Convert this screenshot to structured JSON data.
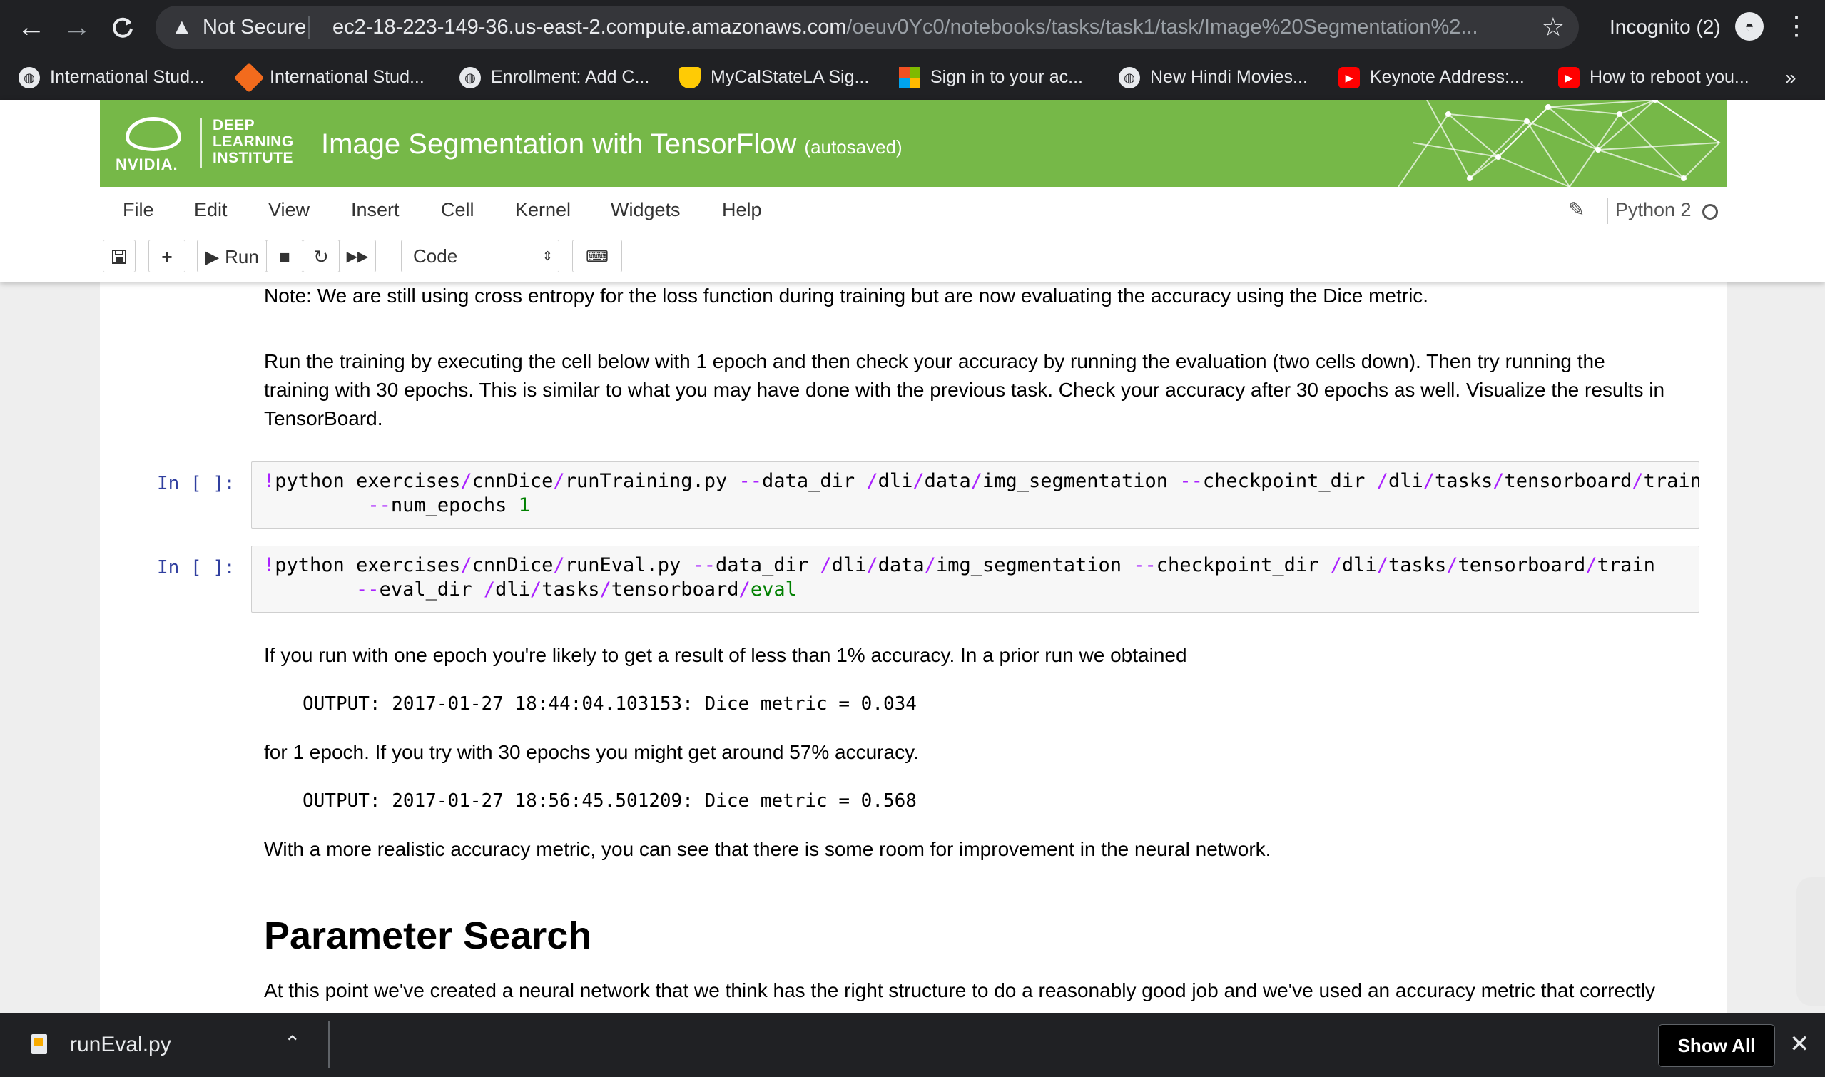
{
  "browser": {
    "nav": {
      "back": "←",
      "forward": "→",
      "reload": "C"
    },
    "security_text": "Not Secure",
    "url_host": "ec2-18-223-149-36.us-east-2.compute.amazonaws.com",
    "url_path": "/oeuv0Yc0/notebooks/tasks/task1/task/Image%20Segmentation%2...",
    "incognito_label": "Incognito (2)",
    "bookmarks": [
      {
        "label": "International Stud...",
        "icon": "globe-icon"
      },
      {
        "label": "International Stud...",
        "icon": "orange-diamond-icon"
      },
      {
        "label": "Enrollment: Add C...",
        "icon": "globe-icon"
      },
      {
        "label": "MyCalStateLA Sig...",
        "icon": "shield-icon"
      },
      {
        "label": "Sign in to your ac...",
        "icon": "microsoft-icon"
      },
      {
        "label": "New Hindi Movies...",
        "icon": "globe-icon"
      },
      {
        "label": "Keynote Address:...",
        "icon": "youtube-icon"
      },
      {
        "label": "How to reboot you...",
        "icon": "youtube-icon"
      }
    ],
    "bookmarks_more": "»"
  },
  "jupyter": {
    "logo_word": "NVIDIA.",
    "dli_lines": [
      "DEEP",
      "LEARNING",
      "INSTITUTE"
    ],
    "notebook_title": "Image Segmentation with TensorFlow",
    "autosave": "(autosaved)",
    "menu": [
      "File",
      "Edit",
      "View",
      "Insert",
      "Cell",
      "Kernel",
      "Widgets",
      "Help"
    ],
    "kernel_name": "Python 2",
    "toolbar": {
      "run_label": "Run",
      "cell_type": "Code"
    },
    "brand_color": "#76b848"
  },
  "notebook": {
    "note": "Note: We are still using cross entropy for the loss function during training but are now evaluating the accuracy using the Dice metric.",
    "run_para": [
      "Run the training by executing the cell below with 1 epoch and then check your accuracy by running the evaluation (two cells down). Then try running the",
      "training with 30 epochs. This is similar to what you may have done with the previous task. Check your accuracy after 30 epochs as well. Visualize the results in",
      "TensorBoard."
    ],
    "cell1_prompt": "In [ ]:",
    "cell2_prompt": "In [ ]:",
    "if_para": "If you run with one epoch you're likely to get a result of less than 1% accuracy. In a prior run we obtained",
    "output1": "OUTPUT: 2017-01-27 18:44:04.103153: Dice metric = 0.034",
    "for_para": "for 1 epoch. If you try with 30 epochs you might get around 57% accuracy.",
    "output2": "OUTPUT: 2017-01-27 18:56:45.501209: Dice metric = 0.568",
    "with_para": "With a more realistic accuracy metric, you can see that there is some room for improvement in the neural network.",
    "heading": "Parameter Search",
    "at_para": "At this point we've created a neural network that we think has the right structure to do a reasonably good job and we've used an accuracy metric that correctly"
  },
  "downloads": {
    "file_name": "runEval.py",
    "show_all": "Show All"
  }
}
